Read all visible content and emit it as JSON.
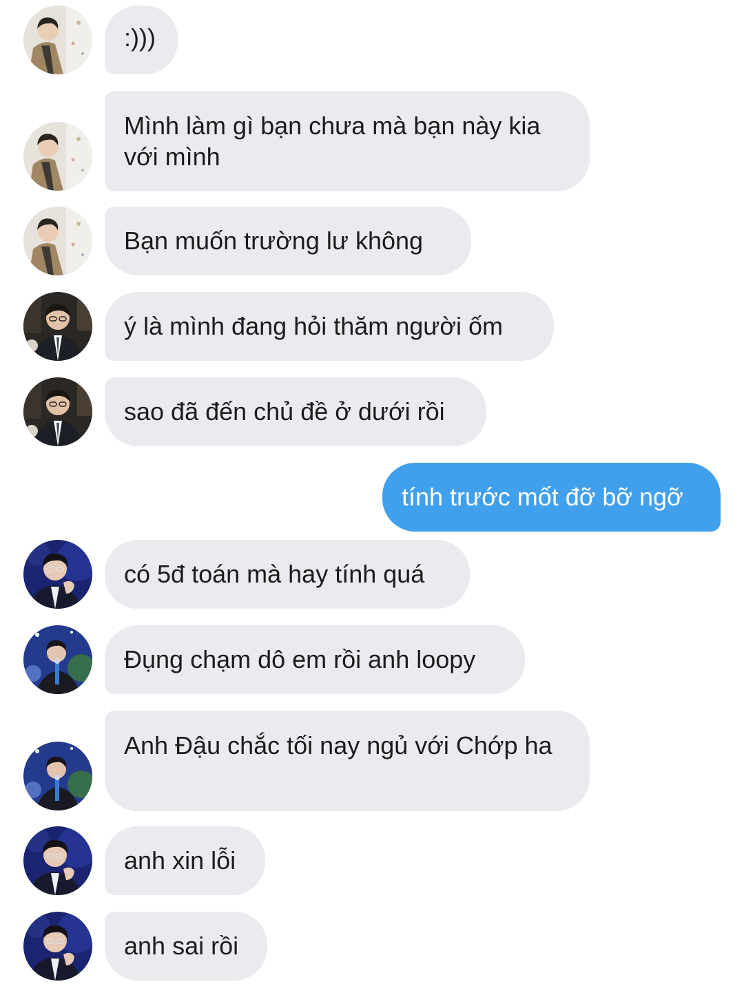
{
  "messages": [
    {
      "sender": "contact-a",
      "direction": "incoming",
      "text": ":)))"
    },
    {
      "sender": "contact-a",
      "direction": "incoming",
      "text": "Mình làm gì bạn chưa mà bạn này kia với mình"
    },
    {
      "sender": "contact-a",
      "direction": "incoming",
      "text": "Bạn muốn trường lư không"
    },
    {
      "sender": "contact-b",
      "direction": "incoming",
      "text": "ý là mình đang hỏi thăm người ốm"
    },
    {
      "sender": "contact-b",
      "direction": "incoming",
      "text": "sao đã đến chủ đề ở dưới rồi"
    },
    {
      "sender": "me",
      "direction": "outgoing",
      "text": "tính trước mốt đỡ bỡ ngỡ"
    },
    {
      "sender": "contact-c",
      "direction": "incoming",
      "text": "có 5đ toán mà hay tính quá"
    },
    {
      "sender": "contact-d",
      "direction": "incoming",
      "text": "Đụng chạm dô em rồi anh loopy"
    },
    {
      "sender": "contact-d",
      "direction": "incoming",
      "text": "Anh Đậu chắc tối nay ngủ với Chớp ha"
    },
    {
      "sender": "contact-c",
      "direction": "incoming",
      "text": "anh xin lỗi"
    },
    {
      "sender": "contact-c",
      "direction": "incoming",
      "text": "anh sai rồi"
    }
  ],
  "colors": {
    "incoming_bubble": "#e9ebef",
    "outgoing_bubble": "#41a0ec",
    "incoming_text": "#1c1c1c",
    "outgoing_text": "#ffffff"
  }
}
